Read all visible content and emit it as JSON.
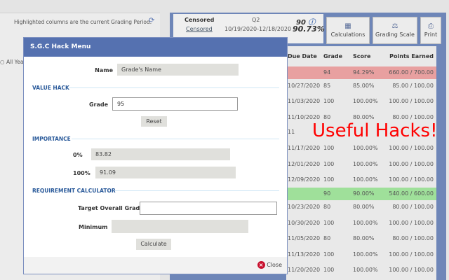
{
  "left": {
    "note": "Highlighted columns are the current Grading Period.",
    "radio_label": "All Yea"
  },
  "scorecard": {
    "name": "Censored",
    "link": "Censored",
    "period": "Q2",
    "dates": "10/19/2020-12/18/2020",
    "grade": "90",
    "percent": "90.73%"
  },
  "toolbar": {
    "calculations": "Calculations",
    "grading_scale": "Grading Scale",
    "print": "Print"
  },
  "table": {
    "headers": [
      "Due Date",
      "Grade",
      "Score",
      "Points Earned"
    ],
    "rows": [
      {
        "date": "",
        "grade": "94",
        "score": "94.29%",
        "points": "660.00 / 700.00",
        "highlight": "red"
      },
      {
        "date": "10/27/2020",
        "grade": "85",
        "score": "85.00%",
        "points": "85.00 / 100.00"
      },
      {
        "date": "11/03/2020",
        "grade": "100",
        "score": "100.00%",
        "points": "100.00 / 100.00"
      },
      {
        "date": "11/10/2020",
        "grade": "80",
        "score": "80.00%",
        "points": "80.00 / 100.00"
      },
      {
        "date": "11",
        "grade": "",
        "score": "",
        "points": ""
      },
      {
        "date": "11/17/2020",
        "grade": "100",
        "score": "100.00%",
        "points": "100.00 / 100.00"
      },
      {
        "date": "12/01/2020",
        "grade": "100",
        "score": "100.00%",
        "points": "100.00 / 100.00"
      },
      {
        "date": "12/09/2020",
        "grade": "100",
        "score": "100.00%",
        "points": "100.00 / 100.00"
      },
      {
        "date": "",
        "grade": "90",
        "score": "90.00%",
        "points": "540.00 / 600.00",
        "highlight": "green"
      },
      {
        "date": "10/23/2020",
        "grade": "80",
        "score": "80.00%",
        "points": "80.00 / 100.00"
      },
      {
        "date": "10/30/2020",
        "grade": "100",
        "score": "100.00%",
        "points": "100.00 / 100.00"
      },
      {
        "date": "11/05/2020",
        "grade": "80",
        "score": "80.00%",
        "points": "80.00 / 100.00"
      },
      {
        "date": "11/13/2020",
        "grade": "100",
        "score": "100.00%",
        "points": "100.00 / 100.00"
      },
      {
        "date": "11/20/2020",
        "grade": "100",
        "score": "100.00%",
        "points": "100.00 / 100.00"
      }
    ]
  },
  "overlay": {
    "text": "Useful Hacks!"
  },
  "modal": {
    "title": "S.G.C Hack Menu",
    "name_label": "Name",
    "name_value": "Grade's Name",
    "value_hack": "VALUE HACK",
    "grade_label": "Grade",
    "grade_value": "95",
    "reset": "Reset",
    "importance": "IMPORTANCE",
    "p0_label": "0%",
    "p0_value": "83.82",
    "p100_label": "100%",
    "p100_value": "91.09",
    "req_calc": "REQUIREMENT CALCULATOR",
    "target_label": "Target Overall Grade",
    "target_value": "",
    "minimum_label": "Minimum",
    "minimum_value": "",
    "calculate": "Calculate",
    "close": "Close"
  },
  "colors": {
    "accent": "#5571b0",
    "red_row": "#e8a0a0",
    "green_row": "#9fe09a",
    "overlay_text": "#ff0000"
  }
}
